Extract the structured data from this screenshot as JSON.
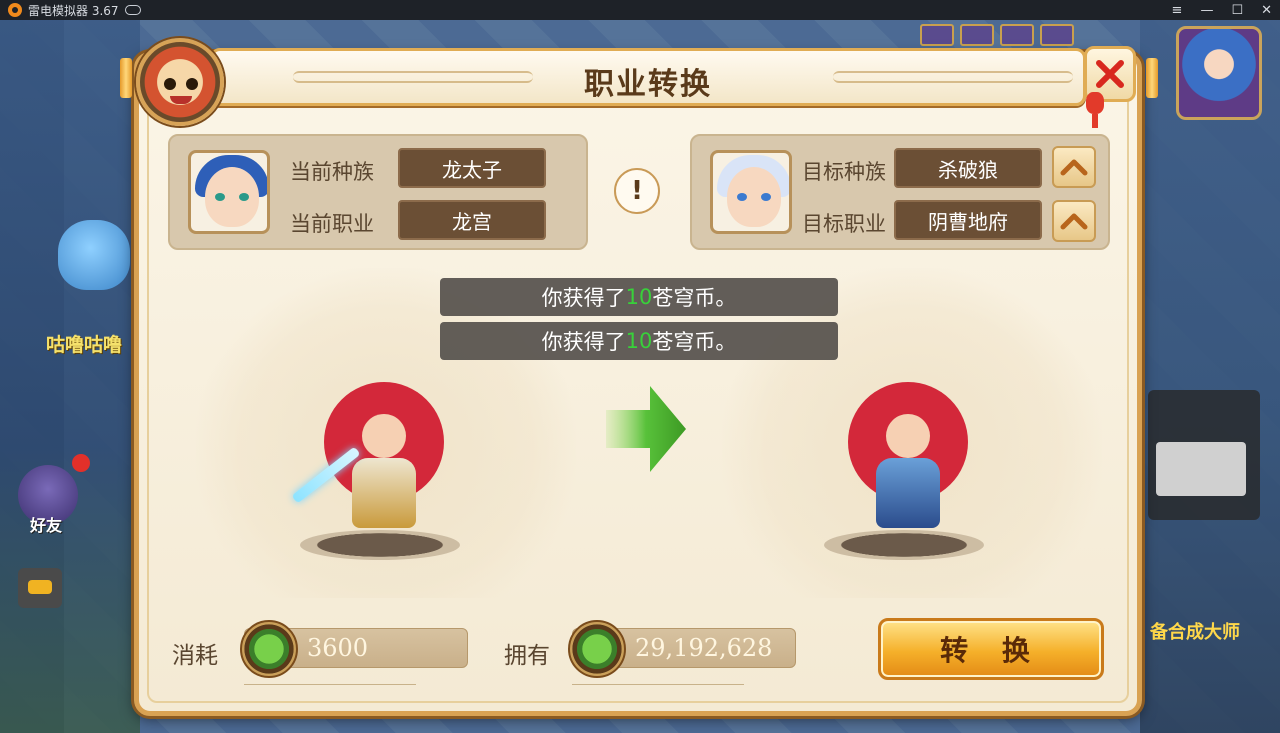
{
  "emulator": {
    "title": "雷电模拟器 3.67",
    "controls": [
      "≡",
      "—",
      "☐",
      "✕"
    ]
  },
  "background": {
    "npc_name": "咕噜咕噜",
    "friend_label": "好友",
    "right_text": "备合成大师"
  },
  "dialog": {
    "title": "职业转换",
    "current": {
      "race_label": "当前种族",
      "race_value": "龙太子",
      "class_label": "当前职业",
      "class_value": "龙宫"
    },
    "target": {
      "race_label": "目标种族",
      "race_value": "杀破狼",
      "class_label": "目标职业",
      "class_value": "阴曹地府"
    },
    "info_glyph": "!",
    "toasts": [
      {
        "prefix": "你获得了",
        "amount": "10",
        "suffix": "苍穹币。"
      },
      {
        "prefix": "你获得了",
        "amount": "10",
        "suffix": "苍穹币。"
      }
    ],
    "cost_label": "消耗",
    "cost_value": "3600",
    "own_label": "拥有",
    "own_value": "29,192,628",
    "convert_button": "转 换"
  },
  "icons": {
    "close": "close-icon",
    "up_arrow": "chevron-up-icon",
    "coin": "cangqiong-coin-icon",
    "arrow": "right-arrow-icon"
  },
  "colors": {
    "toast_amount": "#38d13a",
    "button_gold": "#f5b02a",
    "frame": "#d9a253",
    "arrow_green": "#58c13a"
  }
}
